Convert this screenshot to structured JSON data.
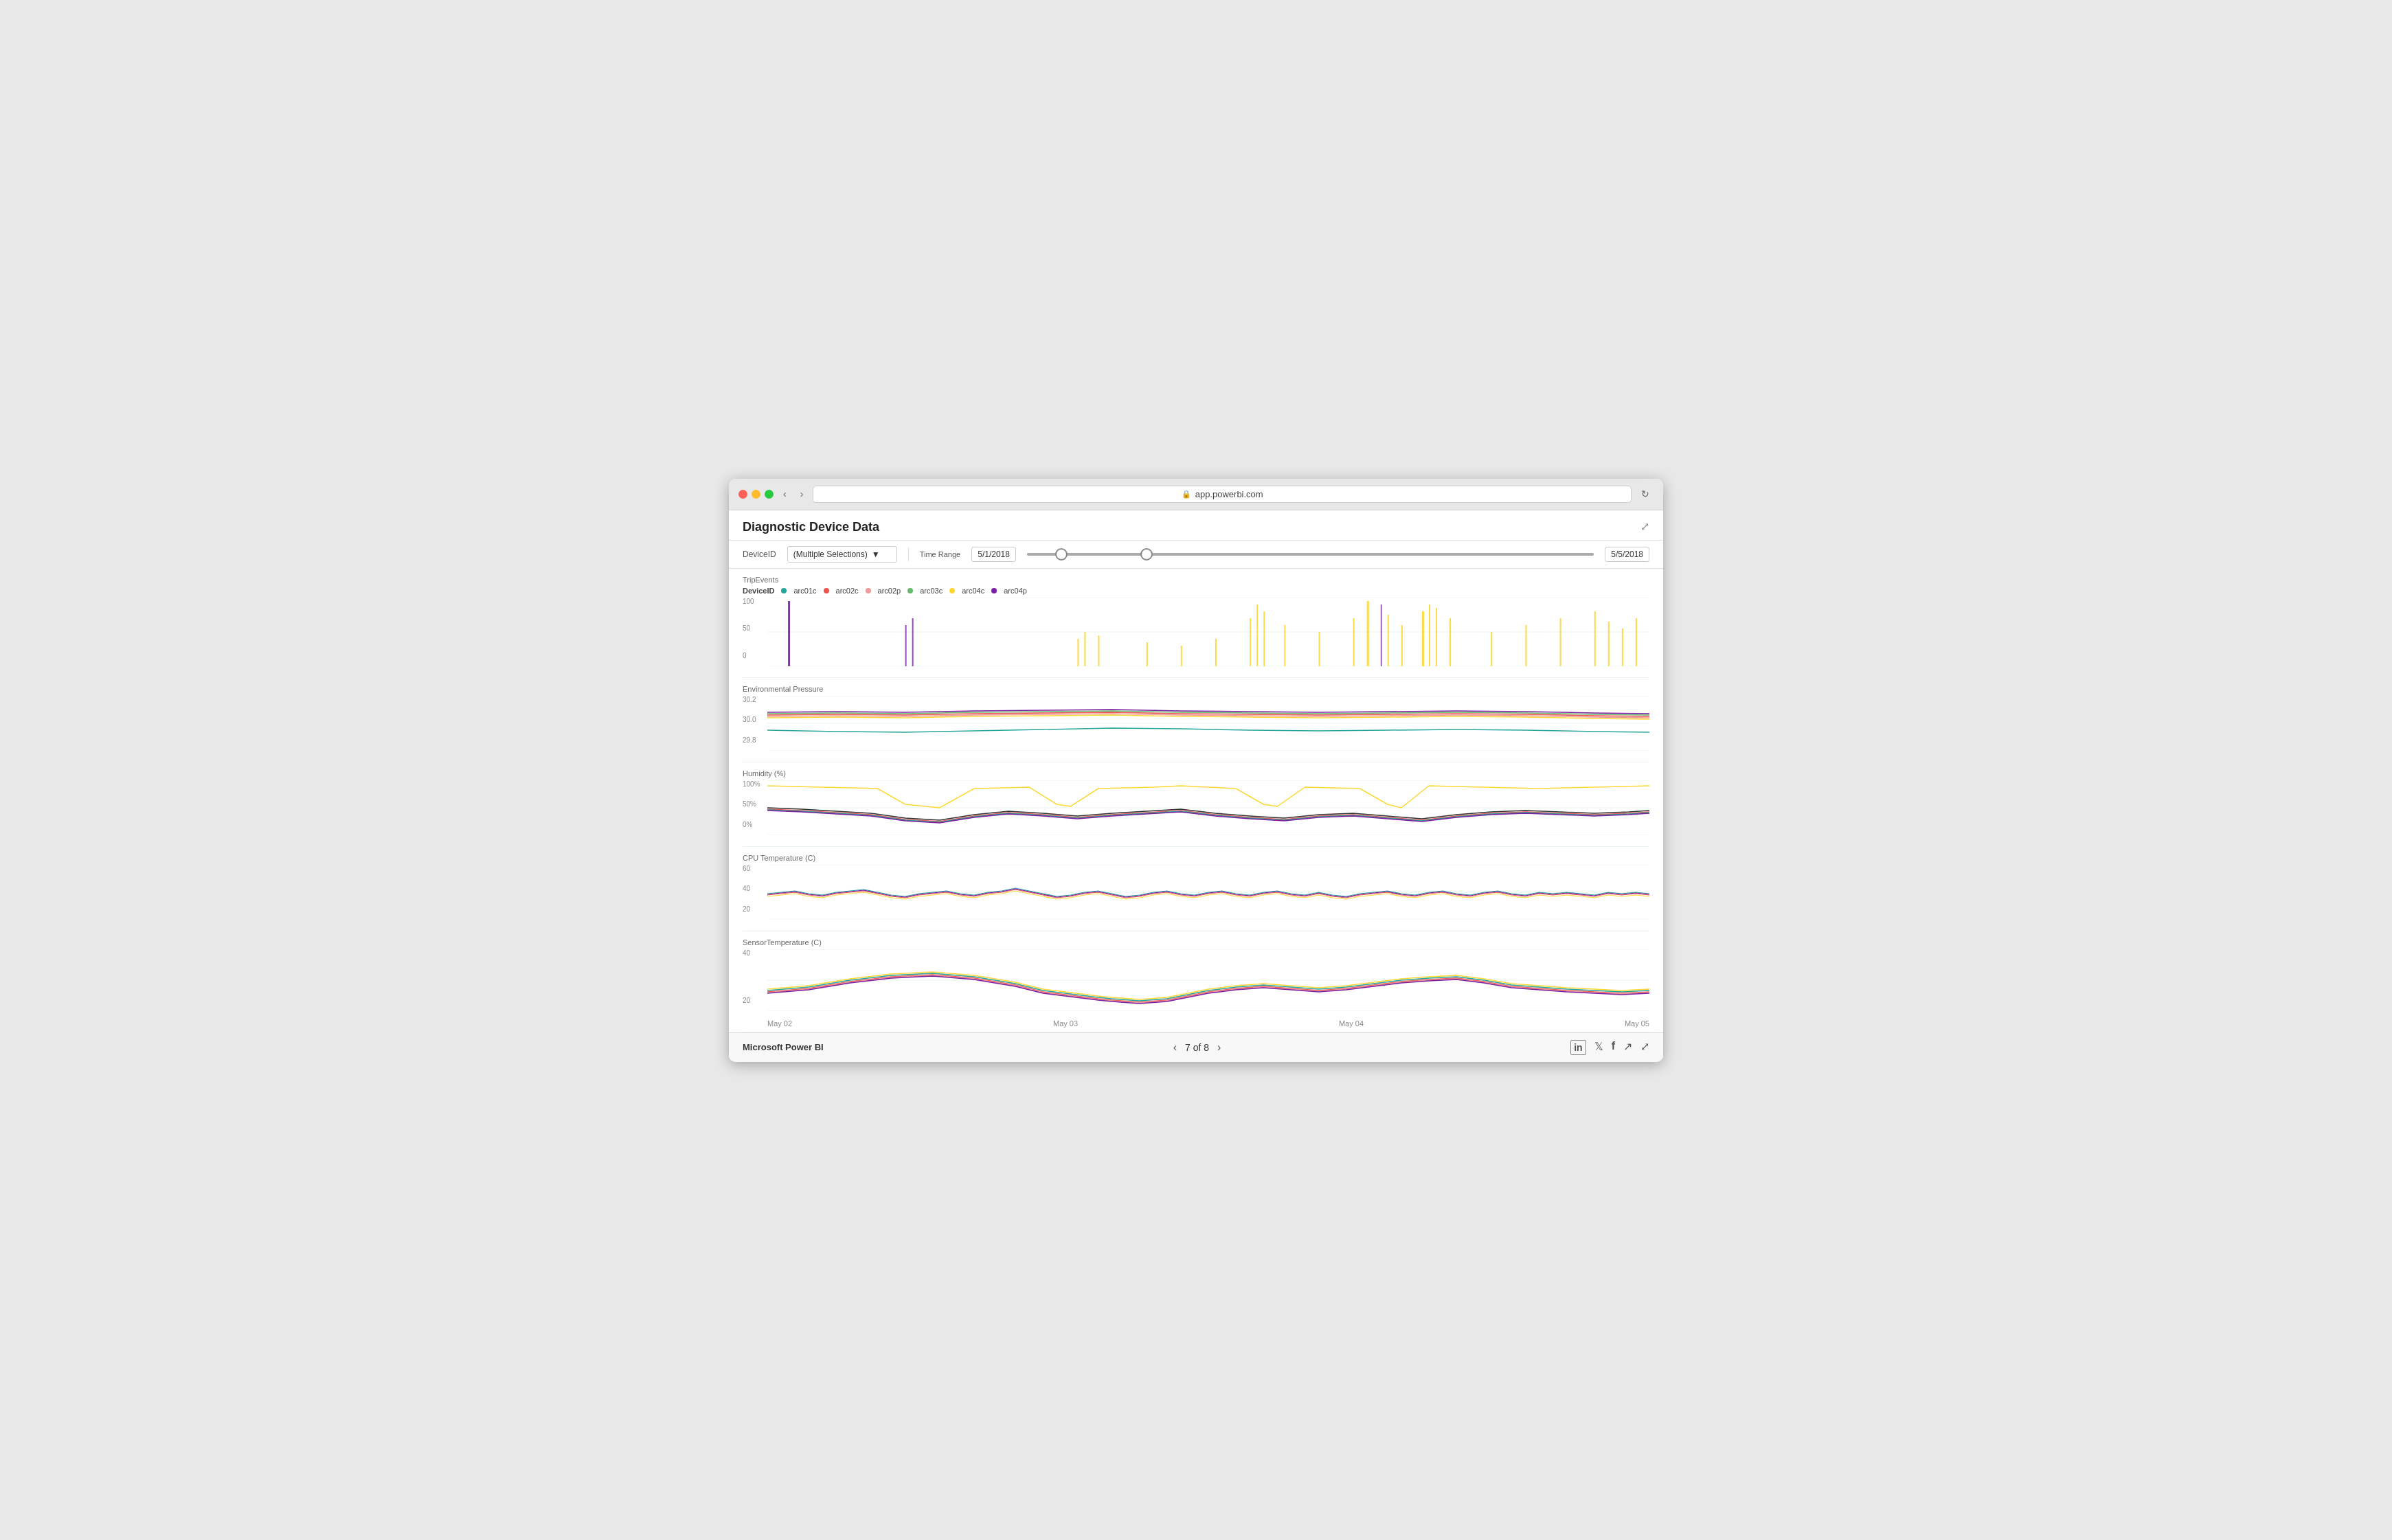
{
  "browser": {
    "url": "app.powerbi.com",
    "title": "app.powerbi.com"
  },
  "dashboard": {
    "title": "Diagnostic Device Data",
    "expand_label": "⤢"
  },
  "filters": {
    "device_id_label": "DeviceID",
    "device_id_value": "(Multiple Selections)",
    "time_range_label": "Time Range",
    "date_start": "5/1/2018",
    "date_end": "5/5/2018"
  },
  "legend": {
    "device_id_prefix": "DeviceID",
    "items": [
      {
        "label": "arc01c",
        "color": "#26a69a"
      },
      {
        "label": "arc02c",
        "color": "#ef5350"
      },
      {
        "label": "arc02p",
        "color": "#ef9a9a"
      },
      {
        "label": "arc03c",
        "color": "#66bb6a"
      },
      {
        "label": "arc04c",
        "color": "#fdd835"
      },
      {
        "label": "arc04p",
        "color": "#7b1fa2"
      }
    ]
  },
  "charts": {
    "trip_events": {
      "title": "TripEvents",
      "y_max": "100",
      "y_mid": "50",
      "y_min": "0",
      "height": 110
    },
    "env_pressure": {
      "title": "Environmental Pressure",
      "y_max": "30.2",
      "y_mid": "30.0",
      "y_min": "29.8",
      "height": 90
    },
    "humidity": {
      "title": "Humidity (%)",
      "y_max": "100%",
      "y_mid": "50%",
      "y_min": "0%",
      "height": 90
    },
    "cpu_temp": {
      "title": "CPU Temperature (C)",
      "y_max": "60",
      "y_mid": "40",
      "y_min": "20",
      "height": 90
    },
    "sensor_temp": {
      "title": "SensorTemperature (C)",
      "y_max": "40",
      "y_mid": "",
      "y_min": "20",
      "height": 90
    }
  },
  "x_axis_labels": [
    "May 02",
    "May 03",
    "May 04",
    "May 05"
  ],
  "footer": {
    "brand": "Microsoft Power BI",
    "page_current": "7",
    "page_total": "8",
    "page_display": "7 of 8"
  },
  "icons": {
    "lock": "🔒",
    "refresh": "↻",
    "back": "‹",
    "forward": "›",
    "prev_page": "‹",
    "next_page": "›",
    "share": "↗",
    "fullscreen": "⤢",
    "linkedin": "in",
    "twitter": "𝕏",
    "facebook": "f"
  }
}
